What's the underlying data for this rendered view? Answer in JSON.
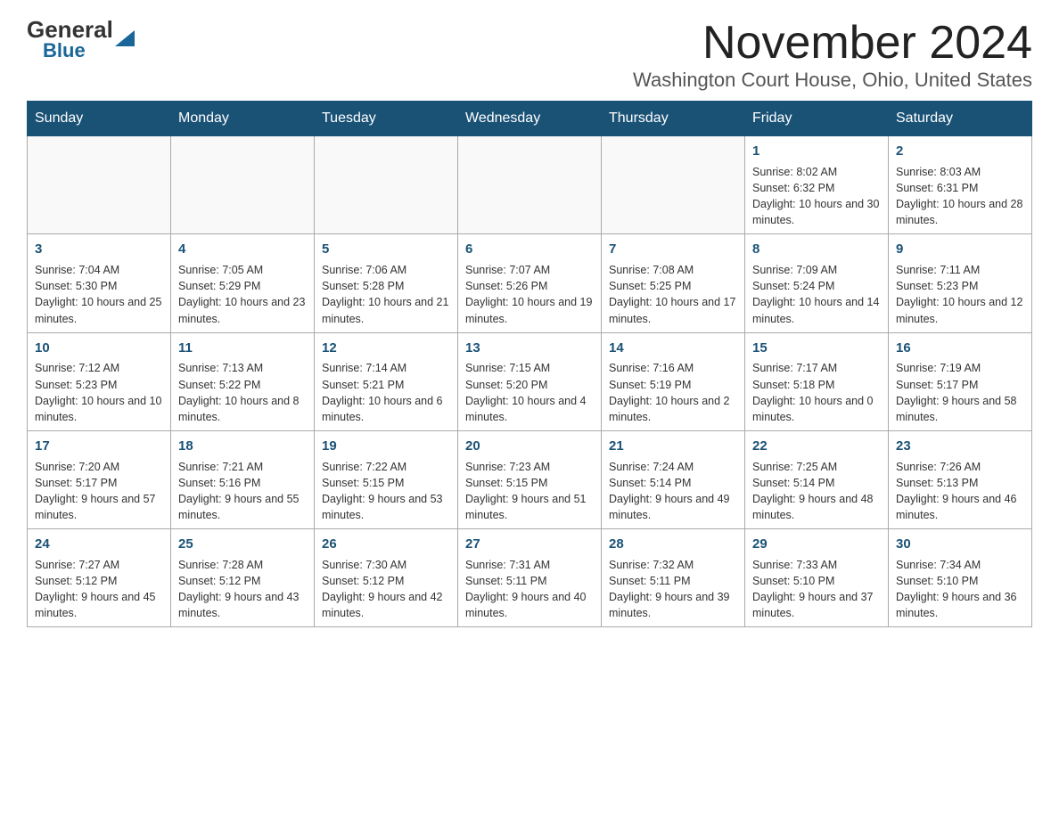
{
  "logo": {
    "general": "General",
    "triangle": "▶",
    "blue": "Blue"
  },
  "header": {
    "month": "November 2024",
    "location": "Washington Court House, Ohio, United States"
  },
  "weekdays": [
    "Sunday",
    "Monday",
    "Tuesday",
    "Wednesday",
    "Thursday",
    "Friday",
    "Saturday"
  ],
  "weeks": [
    [
      {
        "day": "",
        "info": ""
      },
      {
        "day": "",
        "info": ""
      },
      {
        "day": "",
        "info": ""
      },
      {
        "day": "",
        "info": ""
      },
      {
        "day": "",
        "info": ""
      },
      {
        "day": "1",
        "info": "Sunrise: 8:02 AM\nSunset: 6:32 PM\nDaylight: 10 hours and 30 minutes."
      },
      {
        "day": "2",
        "info": "Sunrise: 8:03 AM\nSunset: 6:31 PM\nDaylight: 10 hours and 28 minutes."
      }
    ],
    [
      {
        "day": "3",
        "info": "Sunrise: 7:04 AM\nSunset: 5:30 PM\nDaylight: 10 hours and 25 minutes."
      },
      {
        "day": "4",
        "info": "Sunrise: 7:05 AM\nSunset: 5:29 PM\nDaylight: 10 hours and 23 minutes."
      },
      {
        "day": "5",
        "info": "Sunrise: 7:06 AM\nSunset: 5:28 PM\nDaylight: 10 hours and 21 minutes."
      },
      {
        "day": "6",
        "info": "Sunrise: 7:07 AM\nSunset: 5:26 PM\nDaylight: 10 hours and 19 minutes."
      },
      {
        "day": "7",
        "info": "Sunrise: 7:08 AM\nSunset: 5:25 PM\nDaylight: 10 hours and 17 minutes."
      },
      {
        "day": "8",
        "info": "Sunrise: 7:09 AM\nSunset: 5:24 PM\nDaylight: 10 hours and 14 minutes."
      },
      {
        "day": "9",
        "info": "Sunrise: 7:11 AM\nSunset: 5:23 PM\nDaylight: 10 hours and 12 minutes."
      }
    ],
    [
      {
        "day": "10",
        "info": "Sunrise: 7:12 AM\nSunset: 5:23 PM\nDaylight: 10 hours and 10 minutes."
      },
      {
        "day": "11",
        "info": "Sunrise: 7:13 AM\nSunset: 5:22 PM\nDaylight: 10 hours and 8 minutes."
      },
      {
        "day": "12",
        "info": "Sunrise: 7:14 AM\nSunset: 5:21 PM\nDaylight: 10 hours and 6 minutes."
      },
      {
        "day": "13",
        "info": "Sunrise: 7:15 AM\nSunset: 5:20 PM\nDaylight: 10 hours and 4 minutes."
      },
      {
        "day": "14",
        "info": "Sunrise: 7:16 AM\nSunset: 5:19 PM\nDaylight: 10 hours and 2 minutes."
      },
      {
        "day": "15",
        "info": "Sunrise: 7:17 AM\nSunset: 5:18 PM\nDaylight: 10 hours and 0 minutes."
      },
      {
        "day": "16",
        "info": "Sunrise: 7:19 AM\nSunset: 5:17 PM\nDaylight: 9 hours and 58 minutes."
      }
    ],
    [
      {
        "day": "17",
        "info": "Sunrise: 7:20 AM\nSunset: 5:17 PM\nDaylight: 9 hours and 57 minutes."
      },
      {
        "day": "18",
        "info": "Sunrise: 7:21 AM\nSunset: 5:16 PM\nDaylight: 9 hours and 55 minutes."
      },
      {
        "day": "19",
        "info": "Sunrise: 7:22 AM\nSunset: 5:15 PM\nDaylight: 9 hours and 53 minutes."
      },
      {
        "day": "20",
        "info": "Sunrise: 7:23 AM\nSunset: 5:15 PM\nDaylight: 9 hours and 51 minutes."
      },
      {
        "day": "21",
        "info": "Sunrise: 7:24 AM\nSunset: 5:14 PM\nDaylight: 9 hours and 49 minutes."
      },
      {
        "day": "22",
        "info": "Sunrise: 7:25 AM\nSunset: 5:14 PM\nDaylight: 9 hours and 48 minutes."
      },
      {
        "day": "23",
        "info": "Sunrise: 7:26 AM\nSunset: 5:13 PM\nDaylight: 9 hours and 46 minutes."
      }
    ],
    [
      {
        "day": "24",
        "info": "Sunrise: 7:27 AM\nSunset: 5:12 PM\nDaylight: 9 hours and 45 minutes."
      },
      {
        "day": "25",
        "info": "Sunrise: 7:28 AM\nSunset: 5:12 PM\nDaylight: 9 hours and 43 minutes."
      },
      {
        "day": "26",
        "info": "Sunrise: 7:30 AM\nSunset: 5:12 PM\nDaylight: 9 hours and 42 minutes."
      },
      {
        "day": "27",
        "info": "Sunrise: 7:31 AM\nSunset: 5:11 PM\nDaylight: 9 hours and 40 minutes."
      },
      {
        "day": "28",
        "info": "Sunrise: 7:32 AM\nSunset: 5:11 PM\nDaylight: 9 hours and 39 minutes."
      },
      {
        "day": "29",
        "info": "Sunrise: 7:33 AM\nSunset: 5:10 PM\nDaylight: 9 hours and 37 minutes."
      },
      {
        "day": "30",
        "info": "Sunrise: 7:34 AM\nSunset: 5:10 PM\nDaylight: 9 hours and 36 minutes."
      }
    ]
  ]
}
